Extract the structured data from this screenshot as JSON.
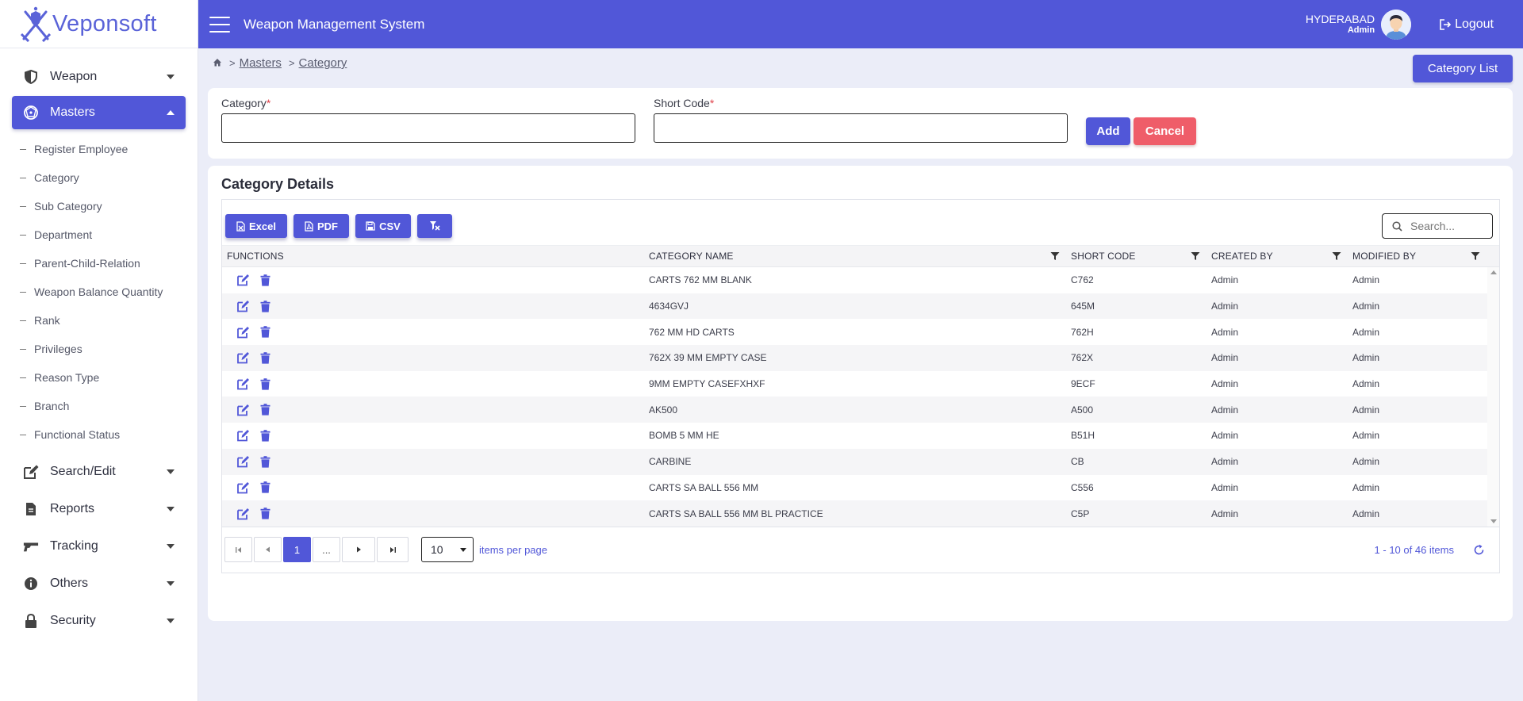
{
  "brand": {
    "logo_text": "Veponsoft"
  },
  "header": {
    "title": "Weapon Management System",
    "location": "HYDERABAD",
    "role": "Admin",
    "logout_label": "Logout"
  },
  "sidebar": {
    "weapon": "Weapon",
    "masters": "Masters",
    "sub_items": [
      "Register Employee",
      "Category",
      "Sub Category",
      "Department",
      "Parent-Child-Relation",
      "Weapon Balance Quantity",
      "Rank",
      "Privileges",
      "Reason Type",
      "Branch",
      "Functional Status"
    ],
    "search_edit": "Search/Edit",
    "reports": "Reports",
    "tracking": "Tracking",
    "others": "Others",
    "security": "Security"
  },
  "breadcrumb": {
    "masters": "Masters",
    "category": "Category"
  },
  "category_list_button": "Category List",
  "form": {
    "category_label": "Category",
    "short_code_label": "Short Code",
    "required_mark": "*",
    "category_value": "",
    "short_code_value": "",
    "add_label": "Add",
    "cancel_label": "Cancel"
  },
  "details": {
    "title": "Category Details",
    "toolbar": {
      "excel": "Excel",
      "pdf": "PDF",
      "csv": "CSV"
    },
    "search_placeholder": "Search...",
    "columns": [
      "FUNCTIONS",
      "CATEGORY NAME",
      "SHORT CODE",
      "CREATED BY",
      "MODIFIED BY"
    ],
    "rows": [
      {
        "name": "CARTS 762 MM BLANK",
        "code": "C762",
        "created_by": "Admin",
        "modified_by": "Admin"
      },
      {
        "name": "4634GVJ",
        "code": "645M",
        "created_by": "Admin",
        "modified_by": "Admin"
      },
      {
        "name": "762 MM HD CARTS",
        "code": "762H",
        "created_by": "Admin",
        "modified_by": "Admin"
      },
      {
        "name": "762X 39 MM EMPTY CASE",
        "code": "762X",
        "created_by": "Admin",
        "modified_by": "Admin"
      },
      {
        "name": "9MM EMPTY CASEFXHXF",
        "code": "9ECF",
        "created_by": "Admin",
        "modified_by": "Admin"
      },
      {
        "name": "AK500",
        "code": "A500",
        "created_by": "Admin",
        "modified_by": "Admin"
      },
      {
        "name": "BOMB 5 MM HE",
        "code": "B51H",
        "created_by": "Admin",
        "modified_by": "Admin"
      },
      {
        "name": "CARBINE",
        "code": "CB",
        "created_by": "Admin",
        "modified_by": "Admin"
      },
      {
        "name": "CARTS SA BALL 556 MM",
        "code": "C556",
        "created_by": "Admin",
        "modified_by": "Admin"
      },
      {
        "name": "CARTS SA BALL 556 MM BL PRACTICE",
        "code": "C5P",
        "created_by": "Admin",
        "modified_by": "Admin"
      }
    ],
    "pager": {
      "current_page": "1",
      "ellipsis": "...",
      "page_size": "10",
      "items_per_page_label": "items per page",
      "info": "1 - 10 of 46 items"
    }
  },
  "colors": {
    "primary": "#5157d8",
    "danger": "#ef5d69",
    "background": "#ebedf8"
  }
}
